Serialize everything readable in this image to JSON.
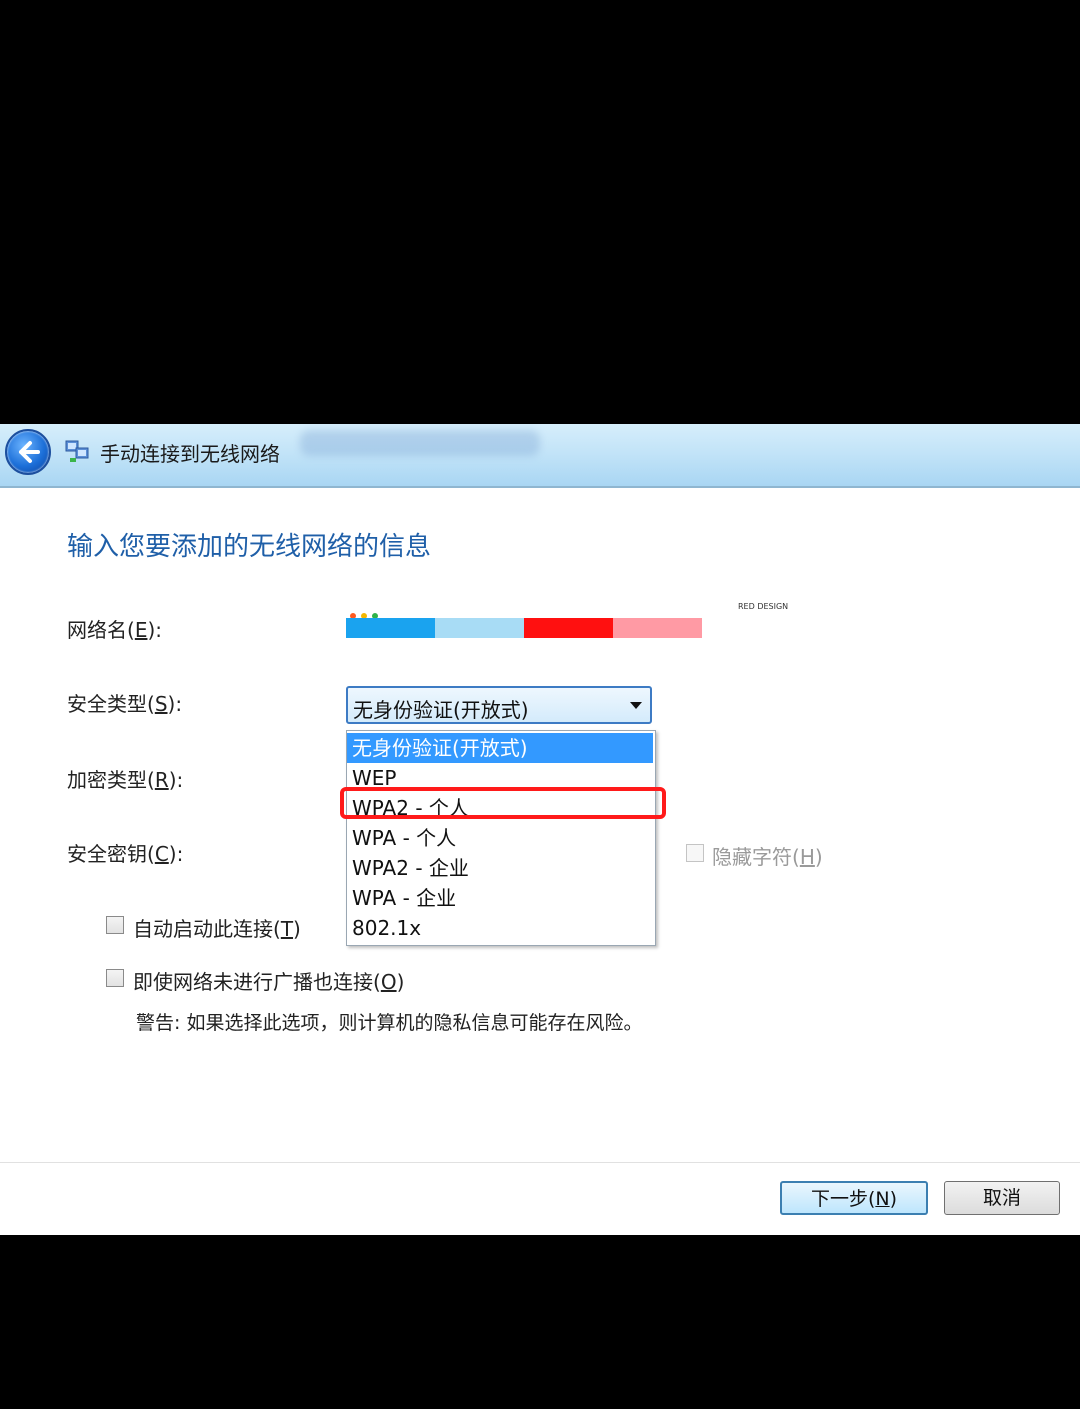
{
  "window": {
    "title": "手动连接到无线网络"
  },
  "heading": "输入您要添加的无线网络的信息",
  "form": {
    "network_name_label": "网络名(E):",
    "security_type_label": "安全类型(S):",
    "encryption_type_label": "加密类型(R):",
    "security_key_label": "安全密钥(C):",
    "security_type_value": "无身份验证(开放式)",
    "hide_chars_label": "隐藏字符(H)"
  },
  "dropdown": {
    "options": [
      "无身份验证(开放式)",
      "WEP",
      "WPA2 - 个人",
      "WPA - 个人",
      "WPA2 - 企业",
      "WPA - 企业",
      "802.1x"
    ],
    "selected_index": 0,
    "highlighted_index": 2
  },
  "watermark": {
    "text": "RED DESIGN",
    "dot_colors": [
      "#ff5a1f",
      "#f5b700",
      "#2fb24a"
    ],
    "bar_colors": [
      "#1aa3ef",
      "#a8dcf5",
      "#ff1010",
      "#ff9aa4"
    ]
  },
  "options": {
    "auto_start_label": "自动启动此连接(T)",
    "auto_start_checked": false,
    "connect_hidden_label": "即使网络未进行广播也连接(O)",
    "connect_hidden_checked": false,
    "warning_text": "警告: 如果选择此选项，则计算机的隐私信息可能存在风险。"
  },
  "buttons": {
    "next_label": "下一步(N)",
    "cancel_label": "取消"
  },
  "colors": {
    "heading": "#1f5fa8",
    "selection": "#3399ff",
    "highlight": "#ff1a1a"
  }
}
